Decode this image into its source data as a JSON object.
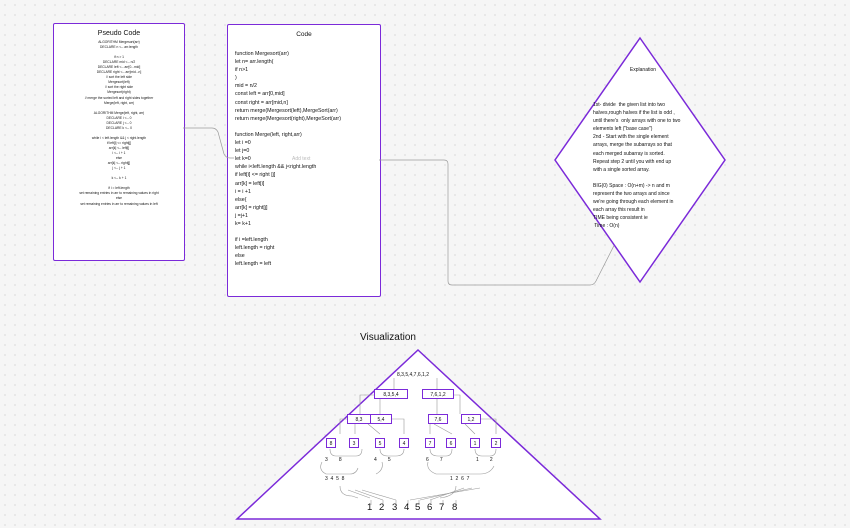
{
  "pseudocode": {
    "title": "Pseudo Code",
    "lines": [
      "ALGORITHM Mergesort(arr)",
      "DECLARE n <-- arr.length",
      "",
      "if n > 1",
      "DECLARE mid <-- n/2",
      "DECLARE left <-- arr[0...mid]",
      "DECLARE right <-- arr[mid...n]",
      "// sort the left side",
      "Mergesort(left)",
      "// sort the right side",
      "Mergesort(right)",
      "// merge the sorted left and right sides together",
      "Merge(left, right, arr)",
      "",
      "ALGORITHM Merge(left, right, arr)",
      "DECLARE i <-- 0",
      "DECLARE j <-- 0",
      "DECLARE k <-- 0",
      "",
      "while i < left.length && j < right.length",
      "if left[i] <= right[j]",
      "arr[k] <-- left[i]",
      "i <-- i + 1",
      "else",
      "arr[k] <-- right[j]",
      "j <-- j + 1",
      "",
      "k <-- k + 1",
      "",
      "if i = left.length",
      "set remaining entries in arr to remaining values in right",
      "else",
      "set remaining entries in arr to remaining values in left"
    ]
  },
  "code": {
    "title": "Code",
    "lines": [
      "function Mergesort(arr)",
      "let n= arr.length(",
      "if n>1",
      ")",
      "mid = n/2",
      "const left = arr[0,mid]",
      "const right = arr[mid,n]",
      "return merge(Mergesort(left),MergeSort(arr)",
      "return merge(Mergesort(right),MergeSort(arr)",
      "",
      "function Merge(left, right,arr)",
      "let i =0",
      "let j=0",
      "let k=0",
      "while i<left.length && j<right.length",
      "if left[i] <= right [j]",
      "arr[k] = left[i]",
      "i = i +1",
      "else{",
      "arr[k] = right[j]",
      "j =j+1",
      "k= k+1",
      "",
      "if i =left.length",
      "left.length = right",
      "else",
      "left.length = left"
    ]
  },
  "add_text_placeholder": "Add text",
  "explanation": {
    "title": "Explanation",
    "lines": [
      "1st- divide  the given list into two",
      "halves,rough halves if the list is odd ,",
      "until there's  only arrays with one to two",
      "elements left (\"base case\")",
      "2nd - Start with the single element",
      "arrays, merge the subarrays so that",
      "each merged subarray is sorted.",
      "Repeat step 2 until you with end up",
      "with a single sorted array.",
      "",
      "BIG(0) Space : O(n+m) -> n and m",
      "represent the two arrays and since",
      "we're going through each element in",
      "each array this result in",
      "TIME being consistent ie",
      " Time : O(n)"
    ]
  },
  "visualization": {
    "title": "Visualization",
    "root": "8,3,5,4,7,6,1,2",
    "halves": [
      "8,3,5,4",
      "7,6,1,2"
    ],
    "quarters": [
      "8,3",
      "5,4",
      "7,6",
      "1,2"
    ],
    "singles": [
      "8",
      "3",
      "5",
      "4",
      "7",
      "6",
      "1",
      "2"
    ],
    "pair_labels": [
      "3        8",
      "4        5",
      "6        7",
      "1        2"
    ],
    "merged_labels": [
      "3  4  5  8",
      "1  2  6  7"
    ],
    "sorted": [
      "1",
      "2",
      "3",
      "4",
      "5",
      "6",
      "7",
      "8"
    ]
  },
  "colors": {
    "accent": "#7b2ad9",
    "connector": "#9a9a9a"
  }
}
